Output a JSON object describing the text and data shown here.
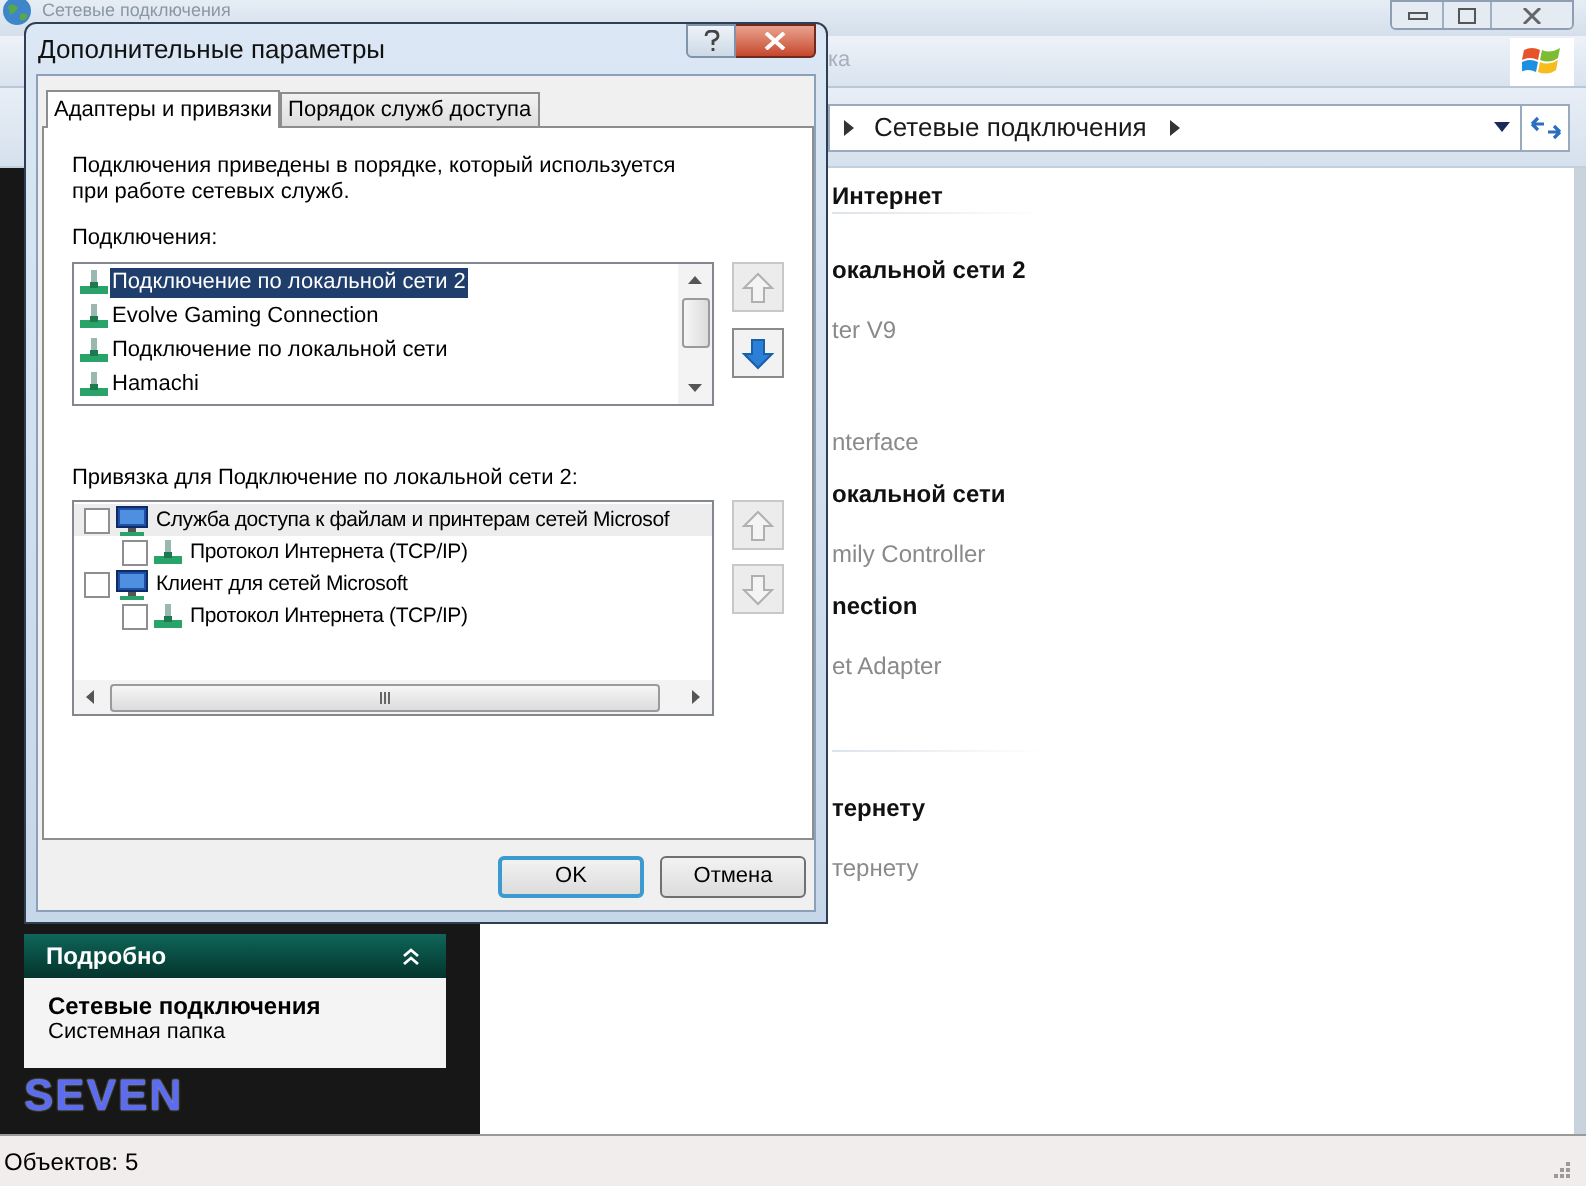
{
  "explorer": {
    "title": "Сетевые подключения",
    "menu_bar": {
      "text": "ка"
    },
    "address_bar": {
      "segments": [
        "Сетевые подключения"
      ]
    },
    "details_panel": {
      "header": "Подробно",
      "expanded": true,
      "name": "Сетевые подключения",
      "type": "Системная папка"
    },
    "logo": "SEVEN",
    "groups": [
      {
        "header": "Интернет",
        "tiles": [
          {
            "name": "окальной сети 2",
            "detail": "ter V9"
          },
          {
            "detail": "nterface"
          },
          {
            "name": "окальной сети",
            "detail": "mily Controller"
          },
          {
            "name": "nection",
            "detail": "et Adapter"
          }
        ]
      },
      {
        "tiles": [
          {
            "name": "тернету",
            "detail": "тернету"
          }
        ]
      }
    ],
    "status_bar": "Объектов: 5"
  },
  "dialog": {
    "title": "Дополнительные параметры",
    "tabs": [
      {
        "label": "Адаптеры и привязки",
        "selected": true
      },
      {
        "label": "Порядок служб доступа",
        "selected": false
      }
    ],
    "description": "Подключения приведены в порядке, который используется при работе сетевых служб.",
    "connections_label": "Подключения:",
    "connections": [
      {
        "label": "Подключение по локальной сети 2",
        "selected": true
      },
      {
        "label": "Evolve Gaming Connection",
        "selected": false
      },
      {
        "label": "Подключение по локальной сети",
        "selected": false
      },
      {
        "label": "Hamachi",
        "selected": false
      }
    ],
    "connection_move_buttons": [
      {
        "kind": "up",
        "disabled": true
      },
      {
        "kind": "down",
        "disabled": false
      }
    ],
    "bindings_label": "Привязка для Подключение по локальной сети 2:",
    "bindings": [
      {
        "label": "Служба доступа к файлам и принтерам сетей Microsof",
        "checked": false,
        "selected": true,
        "children": [
          {
            "label": "Протокол Интернета (TCP/IP)",
            "checked": false,
            "selected": false
          }
        ]
      },
      {
        "label": "Клиент для сетей Microsoft",
        "checked": false,
        "selected": false,
        "children": [
          {
            "label": "Протокол Интернета (TCP/IP)",
            "checked": false,
            "selected": false
          }
        ]
      }
    ],
    "binding_move_buttons": [
      {
        "kind": "up",
        "disabled": true
      },
      {
        "kind": "down",
        "disabled": true
      }
    ],
    "buttons": [
      {
        "label": "OK",
        "default": true
      },
      {
        "label": "Отмена",
        "default": false
      }
    ]
  }
}
